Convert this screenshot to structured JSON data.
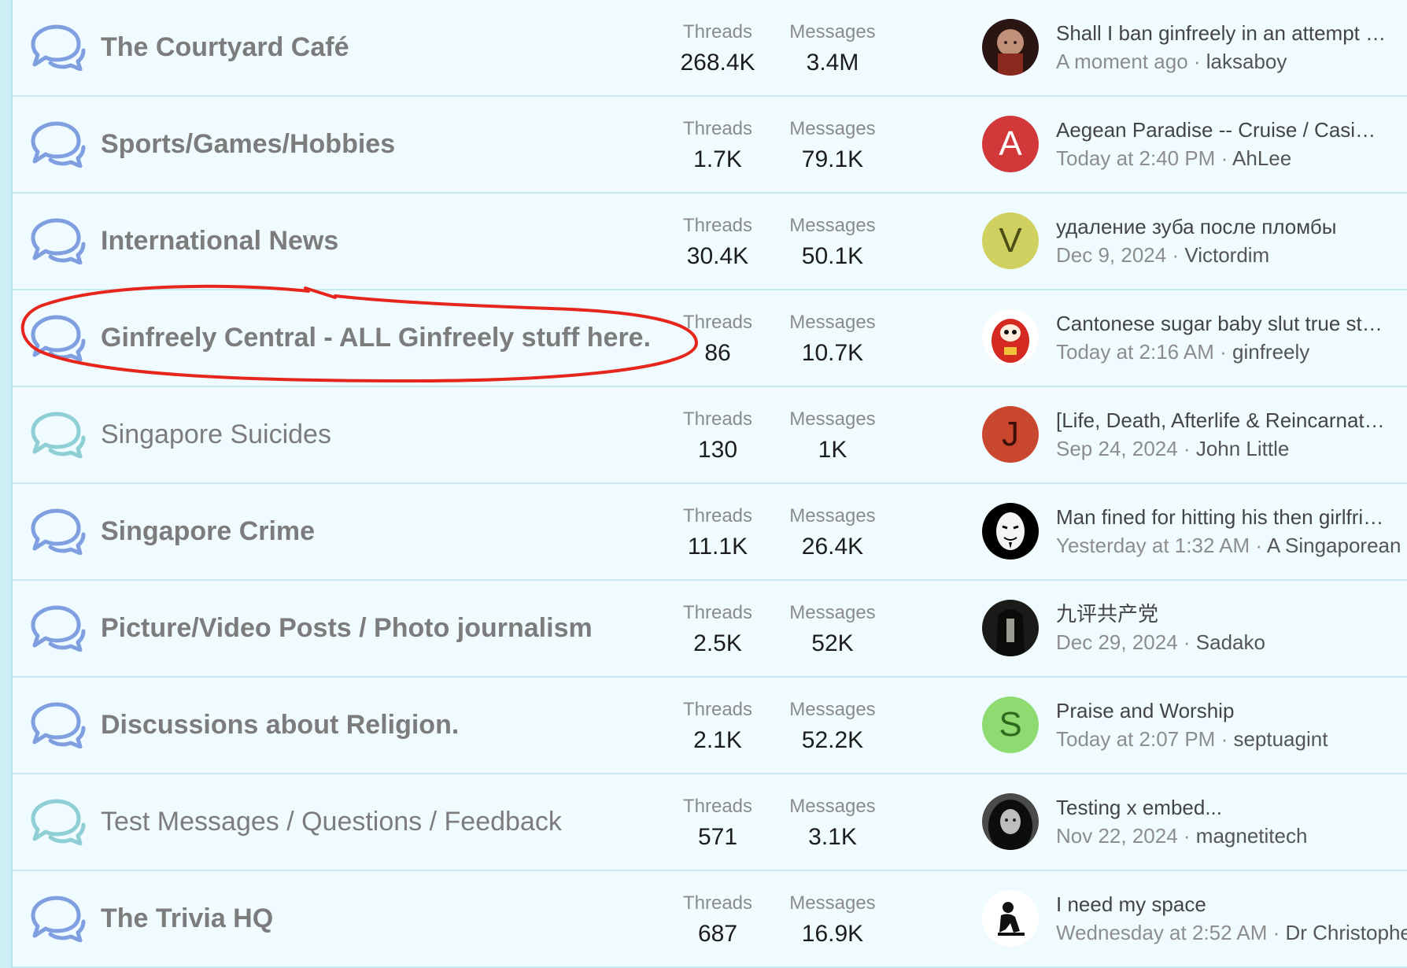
{
  "labels": {
    "threads": "Threads",
    "messages": "Messages",
    "separator": " · "
  },
  "colors": {
    "row_background": "#effbfe",
    "row_divider": "#c8eaf2",
    "icon_unread": "#7f9fe0",
    "icon_read": "#8ecfd6",
    "annotation": "#e6261c"
  },
  "forums": [
    {
      "title": "The Courtyard Café",
      "unread": true,
      "threads": "268.4K",
      "messages": "3.4M",
      "avatar": {
        "type": "photo",
        "icon": "bald-man-photo"
      },
      "last_post": {
        "title": "Shall I ban ginfreely in an attempt to...",
        "time": "A moment ago",
        "user": "laksaboy"
      }
    },
    {
      "title": "Sports/Games/Hobbies",
      "unread": true,
      "threads": "1.7K",
      "messages": "79.1K",
      "avatar": {
        "type": "letter",
        "letter": "A",
        "bg": "#d2383a",
        "fg": "#ffffff"
      },
      "last_post": {
        "title": "Aegean Paradise -- Cruise / Casino ship",
        "time": "Today at 2:40 PM",
        "user": "AhLee"
      }
    },
    {
      "title": "International News",
      "unread": true,
      "threads": "30.4K",
      "messages": "50.1K",
      "avatar": {
        "type": "letter",
        "letter": "V",
        "bg": "#cfd05f",
        "fg": "#4d4d16"
      },
      "last_post": {
        "title": "удаление зуба после пломбы",
        "time": "Dec 9, 2024",
        "user": "Victordim"
      }
    },
    {
      "title": "Ginfreely Central - ALL Ginfreely stuff here.",
      "unread": true,
      "threads": "86",
      "messages": "10.7K",
      "avatar": {
        "type": "photo",
        "icon": "daruma-doll-image"
      },
      "last_post": {
        "title": "Cantonese sugar baby slut true story",
        "time": "Today at 2:16 AM",
        "user": "ginfreely"
      }
    },
    {
      "title": "Singapore Suicides",
      "unread": false,
      "threads": "130",
      "messages": "1K",
      "avatar": {
        "type": "letter",
        "letter": "J",
        "bg": "#c9462f",
        "fg": "#3a1008"
      },
      "last_post": {
        "title": "[Life, Death, Afterlife & Reincarnation]",
        "time": "Sep 24, 2024",
        "user": "John Little"
      }
    },
    {
      "title": "Singapore Crime",
      "unread": true,
      "threads": "11.1K",
      "messages": "26.4K",
      "avatar": {
        "type": "photo",
        "icon": "guy-fawkes-mask-image"
      },
      "last_post": {
        "title": "Man fined for hitting his then girlfriend",
        "time": "Yesterday at 1:32 AM",
        "user": "A Singaporean"
      }
    },
    {
      "title": "Picture/Video Posts / Photo journalism",
      "unread": true,
      "threads": "2.5K",
      "messages": "52K",
      "avatar": {
        "type": "photo",
        "icon": "long-hair-ghost-image"
      },
      "last_post": {
        "title": "九评共产党",
        "time": "Dec 29, 2024",
        "user": "Sadako"
      }
    },
    {
      "title": "Discussions about Religion.",
      "unread": true,
      "threads": "2.1K",
      "messages": "52.2K",
      "avatar": {
        "type": "letter",
        "letter": "S",
        "bg": "#8fdb72",
        "fg": "#2f6b1e"
      },
      "last_post": {
        "title": "Praise and Worship",
        "time": "Today at 2:07 PM",
        "user": "septuagint"
      }
    },
    {
      "title": "Test Messages / Questions / Feedback",
      "unread": false,
      "threads": "571",
      "messages": "3.1K",
      "avatar": {
        "type": "photo",
        "icon": "hooded-figure-photo"
      },
      "last_post": {
        "title": "Testing x embed...",
        "time": "Nov 22, 2024",
        "user": "magnetitech"
      }
    },
    {
      "title": "The Trivia HQ",
      "unread": true,
      "threads": "687",
      "messages": "16.9K",
      "avatar": {
        "type": "photo",
        "icon": "thinker-silhouette-image"
      },
      "last_post": {
        "title": "I need my space",
        "time": "Wednesday at 2:52 AM",
        "user": "Dr Christopher"
      }
    }
  ]
}
